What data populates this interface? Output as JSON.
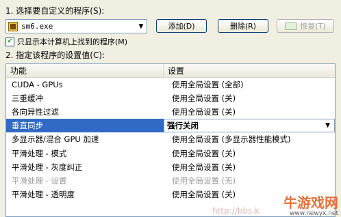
{
  "step1_label": "1. 选择要自定义的程序(S):",
  "program": {
    "icon": "program-exe-icon",
    "value": "sm6.exe"
  },
  "buttons": {
    "add": "添加(D)",
    "delete": "删除(R)",
    "restore": "恢复(T)"
  },
  "only_show_found": {
    "checked": true,
    "label": "只显示本计算机上找到的程序(M)"
  },
  "step2_label": "2. 指定该程序的设置值(C):",
  "table": {
    "headers": {
      "feature": "功能",
      "setting": "设置"
    },
    "rows": [
      {
        "feature": "CUDA - GPUs",
        "setting": "使用全局设置 (全部)",
        "state": "normal"
      },
      {
        "feature": "三重缓冲",
        "setting": "使用全局设置 (关)",
        "state": "normal"
      },
      {
        "feature": "各向异性过滤",
        "setting": "使用全局设置 (关)",
        "state": "normal"
      },
      {
        "feature": "垂直同步",
        "setting": "强行关闭",
        "state": "selected"
      },
      {
        "feature": "多显示器/混合 GPU 加速",
        "setting": "使用全局设置 (多显示器性能模式)",
        "state": "normal"
      },
      {
        "feature": "平滑处理 - 模式",
        "setting": "使用全局设置 (关)",
        "state": "normal"
      },
      {
        "feature": "平滑处理 - 灰度纠正",
        "setting": "使用全局设置 (关)",
        "state": "normal"
      },
      {
        "feature": "平滑处理 - 设置",
        "setting": "使用全局设置 (无)",
        "state": "disabled"
      },
      {
        "feature": "平滑处理 - 透明度",
        "setting": "使用全局设置 (关)",
        "state": "normal"
      },
      {
        "feature": "",
        "setting": "",
        "state": "normal"
      }
    ]
  },
  "watermark": {
    "logo": "牛游戏网",
    "url": "www.newyx.net",
    "mid": "http://bbs.k"
  },
  "colors": {
    "selection": "#316ac5",
    "background": "#f1efe2",
    "border": "#7f9db9"
  }
}
